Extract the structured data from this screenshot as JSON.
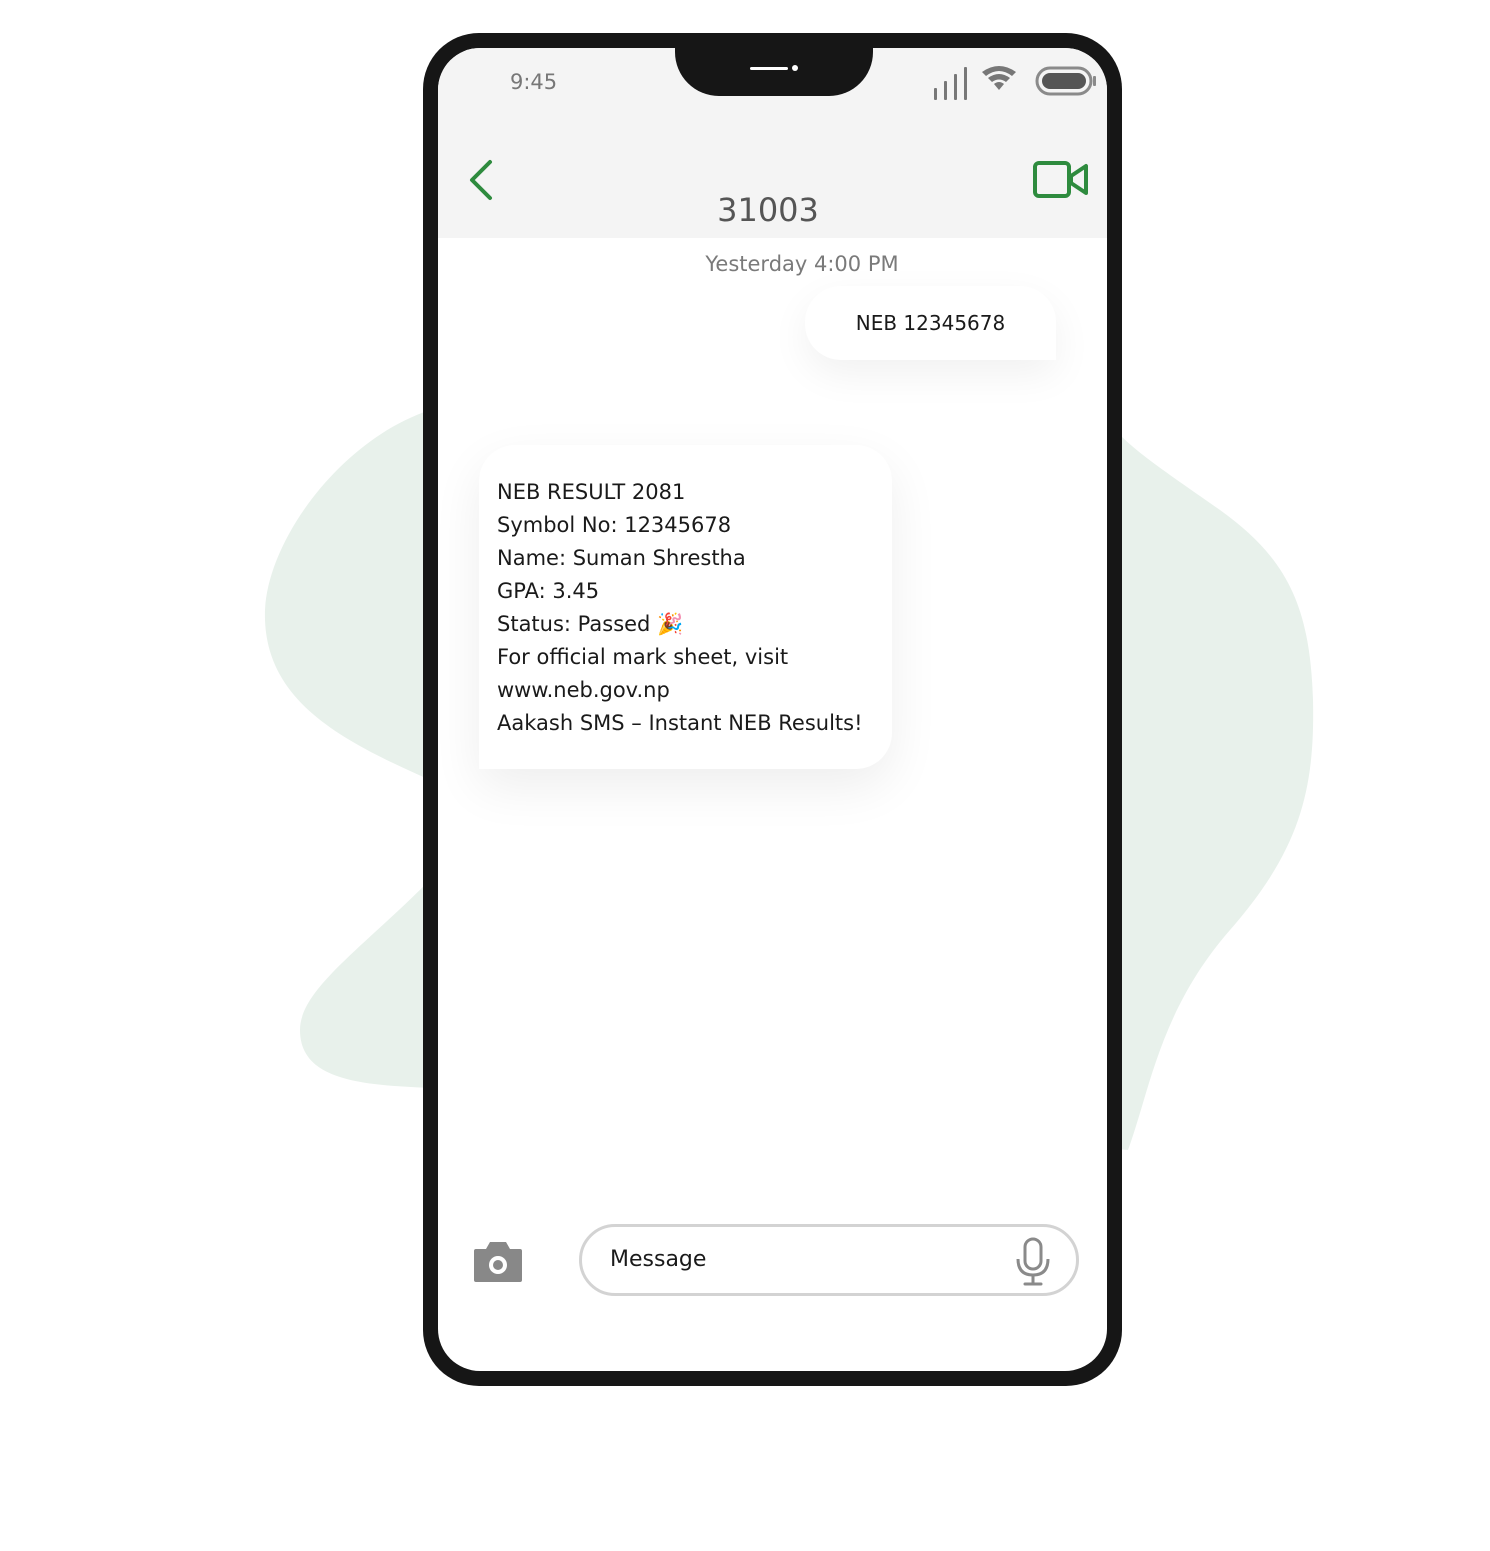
{
  "status_bar": {
    "time": "9:45"
  },
  "header": {
    "contact_name": "31003"
  },
  "conversation": {
    "timestamp": "Yesterday 4:00 PM",
    "outgoing_message": "NEB 12345678",
    "incoming_message_lines": [
      "NEB RESULT 2081",
      "Symbol No: 12345678",
      "Name: Suman Shrestha",
      "GPA: 3.45",
      "Status: Passed 🎉",
      "For official mark sheet, visit",
      "www.neb.gov.np",
      "Aakash SMS – Instant NEB Results!"
    ]
  },
  "composer": {
    "placeholder": "Message"
  },
  "icons": {
    "back": "chevron-left-icon",
    "video": "video-camera-icon",
    "camera": "camera-icon",
    "mic": "microphone-icon",
    "signal": "signal-icon",
    "wifi": "wifi-icon",
    "battery": "battery-icon"
  },
  "colors": {
    "accent": "#2e8b3e",
    "background_blob": "#e8f1eb",
    "header_bg": "#f4f4f4",
    "phone_frame": "#161616"
  }
}
